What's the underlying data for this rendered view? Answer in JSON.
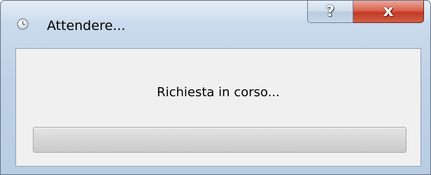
{
  "window": {
    "title": "Attendere...",
    "icon": "clock-icon",
    "frame_color": "#bfd2e7",
    "caption_buttons": {
      "help_glyph": "?",
      "close_glyph": "x",
      "close_color": "#c8422c"
    }
  },
  "dialog": {
    "message": "Richiesta in corso...",
    "progress": {
      "value": 0,
      "fill_color": "#4cc43d"
    }
  }
}
